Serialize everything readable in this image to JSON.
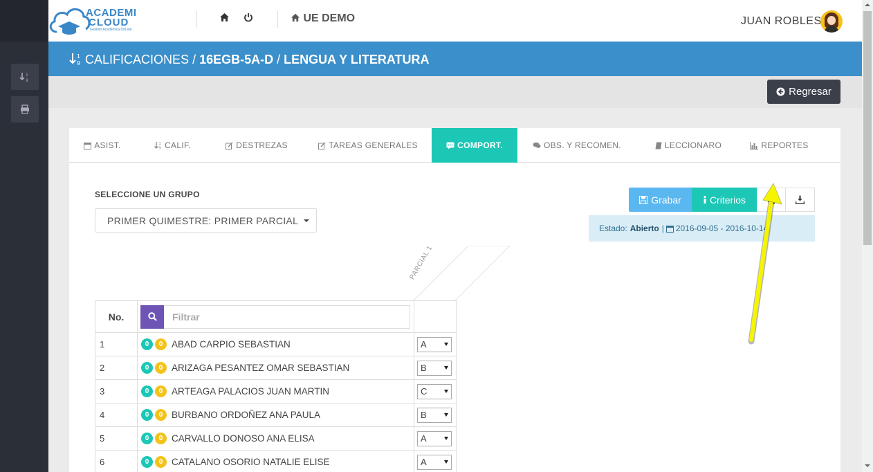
{
  "topbar": {
    "logo_line1": "ACADEMI",
    "logo_line2": "CLOUD",
    "logo_sub": "Gestión Académica OnLine",
    "home_icon": "home-icon",
    "power_icon": "power-icon",
    "institution": "UE DEMO",
    "user_name": "JUAN ROBLES"
  },
  "header": {
    "section": "CALIFICACIONES",
    "course": "16EGB-5A-D",
    "subject": "LENGUA Y LITERATURA",
    "sep": "/"
  },
  "toolbar": {
    "back_label": "Regresar"
  },
  "tabs": [
    {
      "label": "ASIST.",
      "icon": "calendar-icon"
    },
    {
      "label": "CALIF.",
      "icon": "sort-numeric-icon"
    },
    {
      "label": "DESTREZAS",
      "icon": "edit-icon"
    },
    {
      "label": "TAREAS GENERALES",
      "icon": "edit-icon"
    },
    {
      "label": "COMPORT.",
      "icon": "comment-icon",
      "active": true
    },
    {
      "label": "OBS. Y RECOMEN.",
      "icon": "comments-icon"
    },
    {
      "label": "LECCIONARO",
      "icon": "book-icon"
    },
    {
      "label": "REPORTES",
      "icon": "bar-chart-icon"
    }
  ],
  "group": {
    "label": "SELECCIONE UN GRUPO",
    "selected": "PRIMER QUIMESTRE: PRIMER PARCIAL"
  },
  "actions": {
    "save_label": "Grabar",
    "criteria_label": "Criterios",
    "print_icon": "print-icon",
    "download_icon": "download-icon"
  },
  "status": {
    "prefix": "Estado:",
    "value": "Abierto",
    "sep": "|",
    "date_range": "2016-09-05 - 2016-10-14"
  },
  "table": {
    "col_no": "No.",
    "filter_placeholder": "Filtrar",
    "column_header": "PARCIAL 1",
    "rows": [
      {
        "no": "1",
        "name": "ABAD CARPIO SEBASTIAN",
        "b1": "0",
        "b2": "0",
        "grade": "A"
      },
      {
        "no": "2",
        "name": "ARIZAGA PESANTEZ OMAR SEBASTIAN",
        "b1": "0",
        "b2": "0",
        "grade": "B"
      },
      {
        "no": "3",
        "name": "ARTEAGA PALACIOS JUAN MARTIN",
        "b1": "0",
        "b2": "0",
        "grade": "C"
      },
      {
        "no": "4",
        "name": "BURBANO ORDOÑEZ ANA PAULA",
        "b1": "0",
        "b2": "0",
        "grade": "B"
      },
      {
        "no": "5",
        "name": "CARVALLO DONOSO ANA ELISA",
        "b1": "0",
        "b2": "0",
        "grade": "A"
      },
      {
        "no": "6",
        "name": "CATALANO OSORIO NATALIE ELISE",
        "b1": "0",
        "b2": "0",
        "grade": "A"
      }
    ]
  },
  "colors": {
    "blue_header": "#3b8fcb",
    "teal": "#1cc7b6",
    "sky": "#5bb7ef",
    "purple": "#6e55b5",
    "yellow": "#f4c21b",
    "annotation_arrow": "#f5f500"
  }
}
